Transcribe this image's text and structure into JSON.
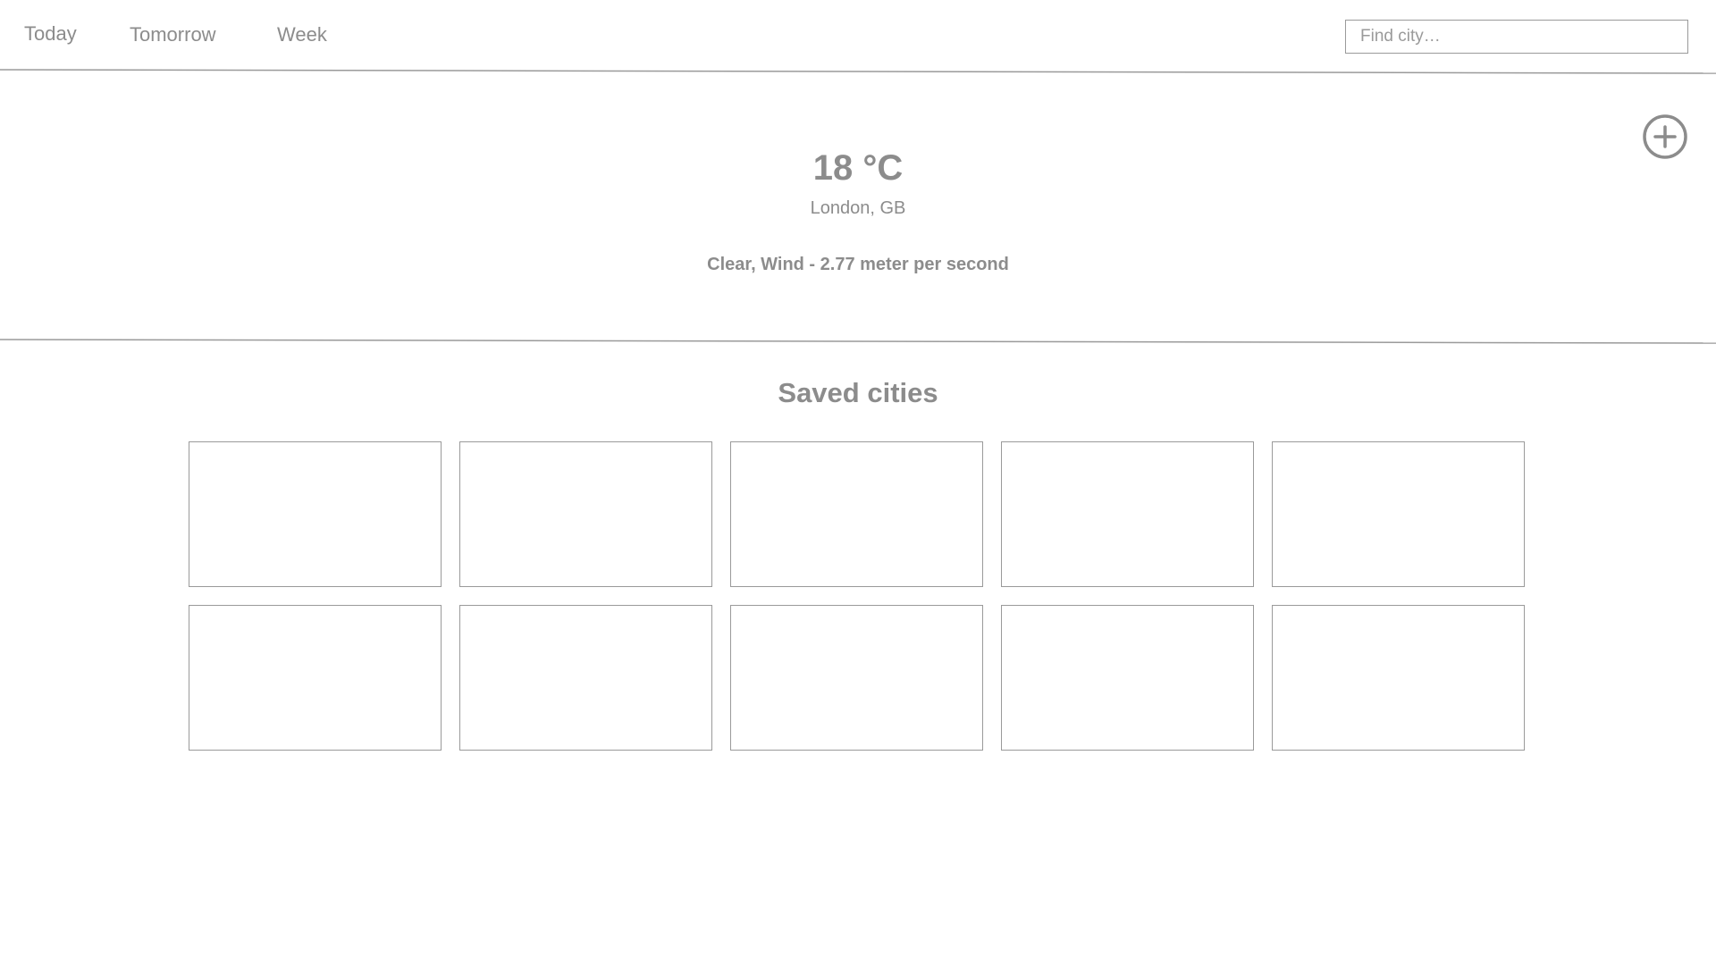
{
  "nav": {
    "tabs": [
      {
        "label": "Today"
      },
      {
        "label": "Tomorrow"
      },
      {
        "label": "Week"
      }
    ],
    "search": {
      "placeholder": "Find city…",
      "value": ""
    }
  },
  "current": {
    "temperature": "18 °C",
    "location": "London, GB",
    "conditions": "Clear, Wind - 2.77 meter per second",
    "add_icon": "plus-circle-icon"
  },
  "saved": {
    "title": "Saved cities",
    "cards": [
      {
        "label": ""
      },
      {
        "label": ""
      },
      {
        "label": ""
      },
      {
        "label": ""
      },
      {
        "label": ""
      },
      {
        "label": ""
      },
      {
        "label": ""
      },
      {
        "label": ""
      },
      {
        "label": ""
      },
      {
        "label": ""
      }
    ]
  },
  "colors": {
    "text": "#8c8c8c",
    "border": "#9a9a9a",
    "background": "#ffffff"
  }
}
